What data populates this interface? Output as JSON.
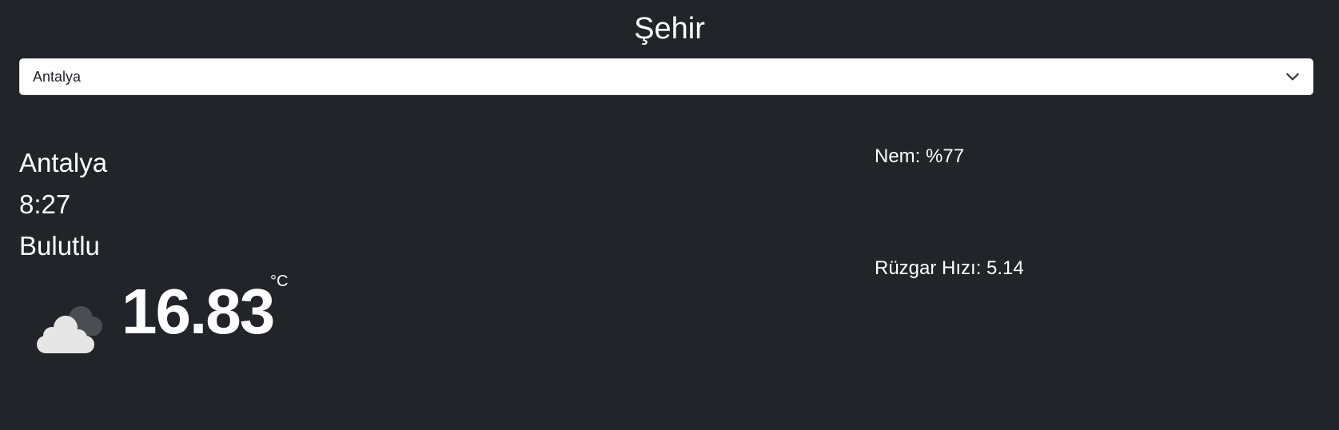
{
  "header": {
    "title": "Şehir"
  },
  "city_select": {
    "selected": "Antalya",
    "icon": "chevron-down-icon"
  },
  "weather": {
    "city": "Antalya",
    "time": "8:27",
    "description": "Bulutlu",
    "temperature": "16.83",
    "unit": "°C",
    "icon": "cloud-icon",
    "humidity": "Nem: %77",
    "wind_speed": "Rüzgar Hızı: 5.14"
  },
  "colors": {
    "background": "#212529",
    "text": "#ffffff",
    "select_background": "#ffffff"
  }
}
